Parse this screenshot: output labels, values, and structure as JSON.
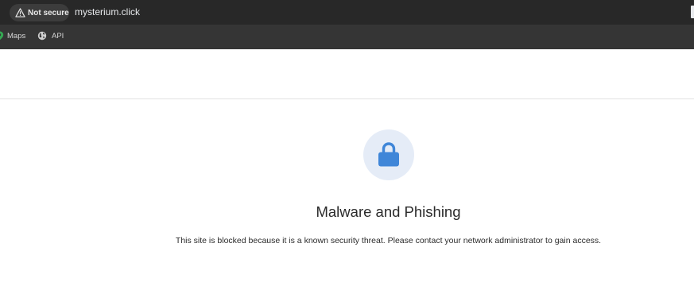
{
  "browser": {
    "security_label": "Not secure",
    "url": "mysterium.click",
    "bookmarks": [
      {
        "label": "Maps",
        "icon": "maps-icon"
      },
      {
        "label": "API",
        "icon": "globe-icon"
      }
    ]
  },
  "block_page": {
    "icon": "lock-icon",
    "title": "Malware and Phishing",
    "message": "This site is blocked because it is a known security threat. Please contact your network administrator to gain access."
  },
  "colors": {
    "chrome_bar": "#282828",
    "bookmarks_bar": "#353535",
    "lock_blue": "#3f86d8",
    "lock_circle": "#e5ecf7"
  }
}
